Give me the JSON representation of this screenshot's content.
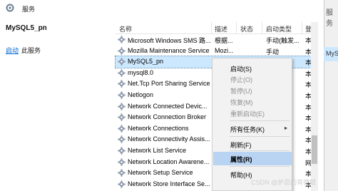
{
  "window": {
    "title": "服务",
    "right_title": "服务",
    "right_item": "MyS"
  },
  "left_pane": {
    "service_title": "MySQL5_pn",
    "start_link": "启动",
    "start_suffix": "此服务"
  },
  "columns": {
    "name": "名称",
    "description": "描述",
    "status": "状态",
    "startup": "启动类型",
    "logon": "登"
  },
  "rows": [
    {
      "name": "Microsoft Windows SMS 路...",
      "description": "根据...",
      "status": "",
      "startup": "手动(触发...",
      "logon": "本"
    },
    {
      "name": "Mozilla Maintenance Service",
      "description": "Mozi...",
      "status": "",
      "startup": "手动",
      "logon": "本"
    },
    {
      "name": "MySQL5_pn",
      "description": "",
      "status": "",
      "startup": "",
      "logon": "本"
    },
    {
      "name": "mysql8.0",
      "description": "",
      "status": "",
      "startup": "",
      "logon": "本"
    },
    {
      "name": "Net.Tcp Port Sharing Service",
      "description": "",
      "status": "",
      "startup": "",
      "logon": "本"
    },
    {
      "name": "Netlogon",
      "description": "",
      "status": "",
      "startup": "",
      "logon": "本"
    },
    {
      "name": "Network Connected Devic...",
      "description": "",
      "status": "",
      "startup": "",
      "logon": "本"
    },
    {
      "name": "Network Connection Broker",
      "description": "",
      "status": "",
      "startup": "",
      "logon": "本"
    },
    {
      "name": "Network Connections",
      "description": "",
      "status": "",
      "startup": "",
      "logon": "本"
    },
    {
      "name": "Network Connectivity Assis...",
      "description": "",
      "status": "",
      "startup": "",
      "logon": "本"
    },
    {
      "name": "Network List Service",
      "description": "",
      "status": "",
      "startup": "",
      "logon": "本"
    },
    {
      "name": "Network Location Awarene...",
      "description": "",
      "status": "",
      "startup": "",
      "logon": "网"
    },
    {
      "name": "Network Setup Service",
      "description": "",
      "status": "",
      "startup": "",
      "logon": "本"
    },
    {
      "name": "Network Store Interface Se...",
      "description": "",
      "status": "",
      "startup": "",
      "logon": "本"
    }
  ],
  "context_menu": {
    "start": "启动(S)",
    "stop": "停止(O)",
    "pause": "暂停(U)",
    "resume": "恢复(M)",
    "restart": "重新启动(E)",
    "all_tasks": "所有任务(K)",
    "refresh": "刷新(F)",
    "properties": "属性(R)",
    "help": "帮助(H)"
  },
  "watermark": "CSDN @炉忌的肯德精",
  "colors": {
    "selection": "#cce8ff",
    "menu_highlight": "#b9d3f3",
    "link": "#0066cc"
  },
  "icons": {
    "gear": "gear-icon",
    "title": "services-icon",
    "submenu": "chevron-right-icon"
  }
}
